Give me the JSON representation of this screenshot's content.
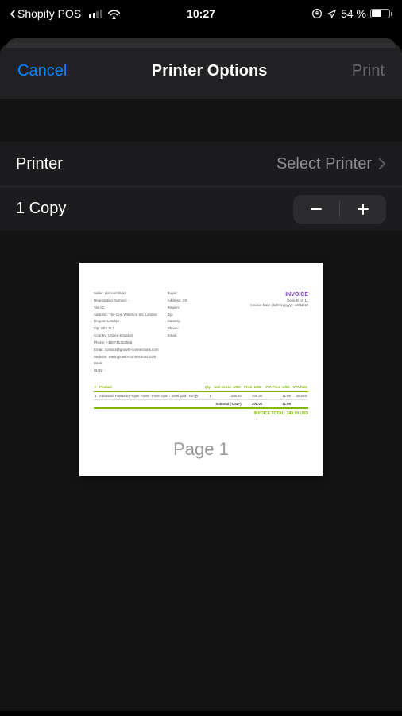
{
  "status": {
    "back_app": "Shopify POS",
    "time": "10:27",
    "battery_pct": "54 %"
  },
  "nav": {
    "cancel": "Cancel",
    "title": "Printer Options",
    "print": "Print"
  },
  "rows": {
    "printer_label": "Printer",
    "printer_value": "Select Printer",
    "copies_label": "1 Copy"
  },
  "preview": {
    "page_label": "Page 1"
  },
  "invoice": {
    "title": "INVOICE",
    "seller": {
      "seller_line": "Seller: discountdicks",
      "reg_line": "Registration Number: -",
      "tax_line": "Tax ID:",
      "address_line": "Address: The Cut, Waterloo Str, London",
      "region_line": "Region: London",
      "zip_line": "Zip: SE1 8LZ",
      "country_line": "Country: United Kingdom",
      "phone_line": "Phone: +460741222556",
      "email_line": "Email: contact@growth-connections.com",
      "website_line": "Website: www.growth-connections.com",
      "bank_line": "Bank:",
      "iban_line": "IBAN: -"
    },
    "buyer": {
      "buyer_line": "Buyer:",
      "address_line": "Address: Str:",
      "region_line": "Region:",
      "zip_line": "Zip:",
      "country_line": "Country:",
      "phone_line": "Phone:",
      "email_line": "Email:"
    },
    "meta": {
      "serie_line": "Serie B nr. 11",
      "date_line": "Invoice Date (dd/mm/yyyy): 19/11/19"
    },
    "table": {
      "headers": {
        "num": "#",
        "product": "Product",
        "qty": "Qty.",
        "unit": "Unit Gross -USD-",
        "price": "Price -USD-",
        "vta_price": "VTA Price -USD-",
        "vta_rate": "VTA Rate"
      },
      "row": {
        "num": "1",
        "product": "Advanced Fantastic Proper Pants - Fresh cyan - Steel gold - NS-jjs",
        "qty": "1",
        "unit": "208.00",
        "price": "208.00",
        "vta_price": "41.99",
        "vta_rate": "20.00%"
      },
      "subtotal_label": "Subtotal (-USD-)",
      "subtotal_price": "208.00",
      "subtotal_vta": "41.99"
    },
    "total": "INVOICE TOTAL: 249.99 USD"
  }
}
